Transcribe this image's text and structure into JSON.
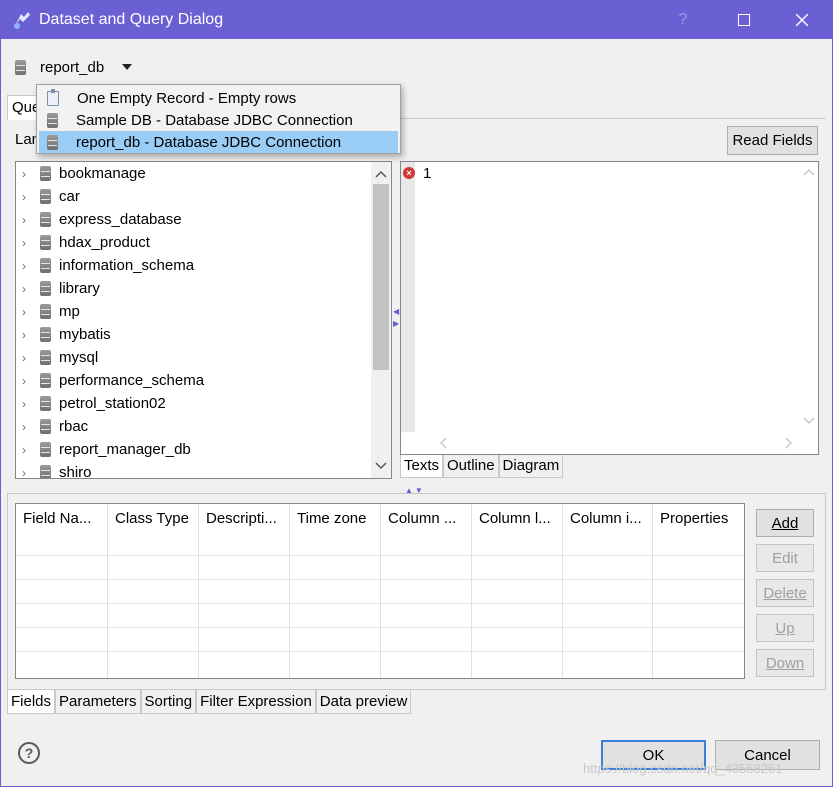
{
  "window": {
    "title": "Dataset and Query Dialog"
  },
  "datasource": {
    "selected": "report_db",
    "options": [
      "One Empty Record - Empty rows",
      "Sample DB - Database JDBC Connection",
      "report_db - Database JDBC Connection"
    ]
  },
  "top_tab": {
    "label": "Que"
  },
  "language_label": "Lan",
  "read_fields_label": "Read Fields",
  "tree": {
    "items": [
      "bookmanage",
      "car",
      "express_database",
      "hdax_product",
      "information_schema",
      "library",
      "mp",
      "mybatis",
      "mysql",
      "performance_schema",
      "petrol_station02",
      "rbac",
      "report_manager_db",
      "shiro"
    ]
  },
  "editor": {
    "line_number": "1",
    "tabs": [
      "Texts",
      "Outline",
      "Diagram"
    ]
  },
  "fields_table": {
    "columns": [
      "Field Na...",
      "Class Type",
      "Descripti...",
      "Time zone",
      "Column ...",
      "Column l...",
      "Column i...",
      "Properties"
    ]
  },
  "side_buttons": {
    "add": "Add",
    "edit": "Edit",
    "delete": "Delete",
    "up": "Up",
    "down": "Down"
  },
  "bottom_tabs": [
    "Fields",
    "Parameters",
    "Sorting",
    "Filter Expression",
    "Data preview"
  ],
  "footer": {
    "ok": "OK",
    "cancel": "Cancel"
  },
  "watermark": "https://blog.csdn.net/qq_43558251",
  "colors": {
    "titlebar": "#6b5fd4",
    "selection": "#99cdf5"
  }
}
